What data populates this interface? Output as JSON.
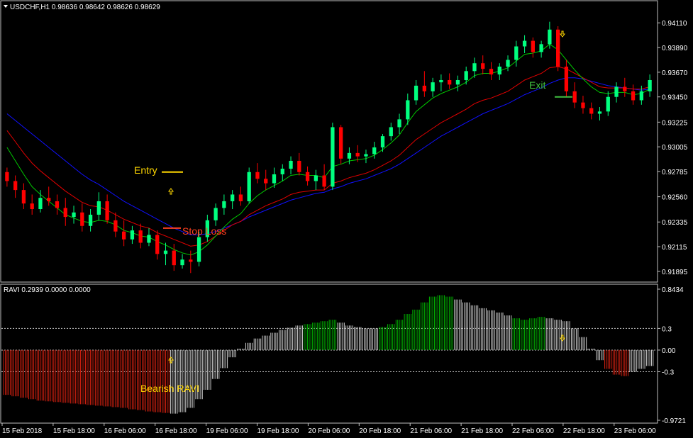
{
  "header": {
    "symbol_line": "USDCHF,H1  0.98636 0.98642 0.98626 0.98629",
    "indicator_line": "RAVI 0.2939 0.0000 0.0000"
  },
  "price_axis": {
    "ticks": [
      "0.94110",
      "0.93890",
      "0.93670",
      "0.93450",
      "0.93225",
      "0.93005",
      "0.92785",
      "0.92560",
      "0.92335",
      "0.92115",
      "0.91895"
    ]
  },
  "ravi_axis": {
    "ticks": [
      "0.8434",
      "0.3",
      "0.00",
      "-0.3",
      "-0.9721"
    ]
  },
  "time_axis": {
    "ticks": [
      "15 Feb 2018",
      "15 Feb 18:00",
      "16 Feb 06:00",
      "16 Feb 18:00",
      "19 Feb 06:00",
      "19 Feb 18:00",
      "20 Feb 06:00",
      "20 Feb 18:00",
      "21 Feb 06:00",
      "21 Feb 18:00",
      "22 Feb 06:00",
      "22 Feb 18:00",
      "23 Feb 06:00"
    ]
  },
  "annotations": {
    "entry": "Entry",
    "stop_loss": "Stop Loss",
    "exit": "Exit",
    "bearish_ravi": "Bearish RAVI"
  },
  "colors": {
    "background": "#000000",
    "bull_candle": "#00ff7f",
    "bear_candle": "#ff0000",
    "ma_fast": "#00c800",
    "ma_mid": "#e00000",
    "ma_slow": "#1010ff",
    "ravi_bull": "#00b000",
    "ravi_bear": "#d02010",
    "ravi_neutral": "#c8c8c8",
    "entry_text": "#ffd700",
    "stop_text": "#ff4020",
    "exit_text": "#40c040",
    "arrow": "#ffd700"
  },
  "chart_data": {
    "type": "candlestick",
    "symbol": "USDCHF",
    "timeframe": "H1",
    "ylim": [
      0.9185,
      0.942
    ],
    "ohlc": [
      [
        0.9278,
        0.9282,
        0.9265,
        0.927
      ],
      [
        0.927,
        0.9275,
        0.9255,
        0.9262
      ],
      [
        0.9262,
        0.9268,
        0.9245,
        0.925
      ],
      [
        0.925,
        0.9258,
        0.924,
        0.9245
      ],
      [
        0.9245,
        0.9262,
        0.9242,
        0.9255
      ],
      [
        0.9255,
        0.9265,
        0.9248,
        0.9252
      ],
      [
        0.9252,
        0.9258,
        0.924,
        0.9246
      ],
      [
        0.9246,
        0.9255,
        0.923,
        0.9238
      ],
      [
        0.9238,
        0.9248,
        0.9232,
        0.9242
      ],
      [
        0.9242,
        0.925,
        0.9225,
        0.923
      ],
      [
        0.923,
        0.9245,
        0.9225,
        0.924
      ],
      [
        0.924,
        0.926,
        0.9235,
        0.9252
      ],
      [
        0.9252,
        0.9258,
        0.9232,
        0.9235
      ],
      [
        0.9235,
        0.9242,
        0.922,
        0.9225
      ],
      [
        0.9225,
        0.9235,
        0.9212,
        0.9218
      ],
      [
        0.9218,
        0.923,
        0.9214,
        0.9226
      ],
      [
        0.9226,
        0.9232,
        0.921,
        0.9215
      ],
      [
        0.9215,
        0.9228,
        0.9212,
        0.9222
      ],
      [
        0.9222,
        0.9226,
        0.92,
        0.9205
      ],
      [
        0.9205,
        0.9215,
        0.9195,
        0.9208
      ],
      [
        0.9208,
        0.9214,
        0.919,
        0.9195
      ],
      [
        0.9195,
        0.9205,
        0.9192,
        0.92
      ],
      [
        0.92,
        0.9208,
        0.9188,
        0.9198
      ],
      [
        0.9198,
        0.9225,
        0.9194,
        0.922
      ],
      [
        0.922,
        0.924,
        0.9216,
        0.9235
      ],
      [
        0.9235,
        0.925,
        0.923,
        0.9246
      ],
      [
        0.9246,
        0.9258,
        0.924,
        0.9252
      ],
      [
        0.9252,
        0.9262,
        0.9245,
        0.9258
      ],
      [
        0.9258,
        0.9265,
        0.9248,
        0.9252
      ],
      [
        0.9252,
        0.9282,
        0.925,
        0.9278
      ],
      [
        0.9278,
        0.9286,
        0.9268,
        0.9272
      ],
      [
        0.9272,
        0.928,
        0.9262,
        0.9268
      ],
      [
        0.9268,
        0.9282,
        0.9264,
        0.9276
      ],
      [
        0.9276,
        0.9285,
        0.927,
        0.9281
      ],
      [
        0.9281,
        0.9292,
        0.9276,
        0.9288
      ],
      [
        0.9288,
        0.9295,
        0.9275,
        0.9278
      ],
      [
        0.9278,
        0.9283,
        0.9266,
        0.927
      ],
      [
        0.927,
        0.928,
        0.9262,
        0.9275
      ],
      [
        0.9275,
        0.9285,
        0.9262,
        0.9265
      ],
      [
        0.9265,
        0.9322,
        0.9262,
        0.9318
      ],
      [
        0.9318,
        0.932,
        0.9285,
        0.929
      ],
      [
        0.929,
        0.93,
        0.9285,
        0.9295
      ],
      [
        0.9295,
        0.9302,
        0.9287,
        0.9292
      ],
      [
        0.9292,
        0.9298,
        0.9286,
        0.9294
      ],
      [
        0.9294,
        0.9305,
        0.929,
        0.93
      ],
      [
        0.93,
        0.9312,
        0.9296,
        0.931
      ],
      [
        0.931,
        0.9322,
        0.9306,
        0.9318
      ],
      [
        0.9318,
        0.933,
        0.9312,
        0.9325
      ],
      [
        0.9325,
        0.9348,
        0.932,
        0.9342
      ],
      [
        0.9342,
        0.936,
        0.9338,
        0.9355
      ],
      [
        0.9355,
        0.9368,
        0.9345,
        0.935
      ],
      [
        0.935,
        0.9362,
        0.9345,
        0.9358
      ],
      [
        0.9358,
        0.9365,
        0.935,
        0.936
      ],
      [
        0.936,
        0.9366,
        0.9352,
        0.9356
      ],
      [
        0.9356,
        0.9364,
        0.935,
        0.936
      ],
      [
        0.936,
        0.9372,
        0.9356,
        0.9368
      ],
      [
        0.9368,
        0.938,
        0.9362,
        0.9375
      ],
      [
        0.9375,
        0.9382,
        0.9365,
        0.937
      ],
      [
        0.937,
        0.9376,
        0.936,
        0.9365
      ],
      [
        0.9365,
        0.9375,
        0.936,
        0.9372
      ],
      [
        0.9372,
        0.9382,
        0.9368,
        0.9378
      ],
      [
        0.9378,
        0.9395,
        0.9372,
        0.939
      ],
      [
        0.939,
        0.94,
        0.9384,
        0.9395
      ],
      [
        0.9395,
        0.9398,
        0.938,
        0.9385
      ],
      [
        0.9385,
        0.9395,
        0.938,
        0.9392
      ],
      [
        0.9392,
        0.9412,
        0.9388,
        0.9405
      ],
      [
        0.9405,
        0.9408,
        0.9368,
        0.9372
      ],
      [
        0.9372,
        0.9378,
        0.9345,
        0.935
      ],
      [
        0.935,
        0.9358,
        0.9335,
        0.934
      ],
      [
        0.934,
        0.9346,
        0.933,
        0.9335
      ],
      [
        0.9335,
        0.934,
        0.9325,
        0.933
      ],
      [
        0.933,
        0.9336,
        0.9324,
        0.9332
      ],
      [
        0.9332,
        0.935,
        0.9328,
        0.9345
      ],
      [
        0.9345,
        0.9358,
        0.934,
        0.9354
      ],
      [
        0.9354,
        0.9362,
        0.9345,
        0.935
      ],
      [
        0.935,
        0.9356,
        0.9338,
        0.9342
      ],
      [
        0.9342,
        0.9355,
        0.9338,
        0.935
      ],
      [
        0.935,
        0.9365,
        0.9345,
        0.936
      ]
    ],
    "ma_fast": [
      0.93,
      0.9288,
      0.9276,
      0.9265,
      0.9258,
      0.9252,
      0.9246,
      0.924,
      0.9237,
      0.9234,
      0.9233,
      0.9235,
      0.9234,
      0.9231,
      0.9226,
      0.9224,
      0.9221,
      0.922,
      0.9216,
      0.9213,
      0.9209,
      0.9206,
      0.9204,
      0.9207,
      0.9213,
      0.9221,
      0.9229,
      0.9236,
      0.9241,
      0.925,
      0.9257,
      0.9262,
      0.9266,
      0.927,
      0.9275,
      0.9276,
      0.9275,
      0.9275,
      0.9273,
      0.9283,
      0.9285,
      0.9288,
      0.9289,
      0.929,
      0.9293,
      0.9298,
      0.9304,
      0.9311,
      0.9322,
      0.9332,
      0.9338,
      0.9344,
      0.9348,
      0.9351,
      0.9354,
      0.9358,
      0.9364,
      0.9366,
      0.9366,
      0.9368,
      0.9371,
      0.9377,
      0.9383,
      0.9384,
      0.9386,
      0.9392,
      0.9387,
      0.9378,
      0.9369,
      0.9361,
      0.9354,
      0.9349,
      0.9348,
      0.9349,
      0.9349,
      0.9347,
      0.9348,
      0.9352
    ],
    "ma_mid": [
      0.9315,
      0.9305,
      0.9295,
      0.9286,
      0.9279,
      0.9273,
      0.9267,
      0.9261,
      0.9256,
      0.9251,
      0.9248,
      0.9247,
      0.9244,
      0.924,
      0.9236,
      0.9233,
      0.923,
      0.9228,
      0.9224,
      0.9221,
      0.9218,
      0.9215,
      0.9212,
      0.9213,
      0.9216,
      0.9221,
      0.9226,
      0.9231,
      0.9234,
      0.924,
      0.9244,
      0.9248,
      0.9251,
      0.9254,
      0.9258,
      0.926,
      0.9261,
      0.9262,
      0.9262,
      0.9268,
      0.927,
      0.9273,
      0.9275,
      0.9277,
      0.928,
      0.9284,
      0.9288,
      0.9293,
      0.93,
      0.9307,
      0.9312,
      0.9317,
      0.9322,
      0.9326,
      0.933,
      0.9334,
      0.9339,
      0.9342,
      0.9344,
      0.9347,
      0.935,
      0.9355,
      0.936,
      0.9363,
      0.9366,
      0.9371,
      0.9372,
      0.937,
      0.9366,
      0.9362,
      0.9358,
      0.9354,
      0.9353,
      0.9353,
      0.9353,
      0.9352,
      0.9352,
      0.9354
    ],
    "ma_slow": [
      0.933,
      0.9324,
      0.9318,
      0.9312,
      0.9306,
      0.93,
      0.9294,
      0.9288,
      0.9282,
      0.9276,
      0.9271,
      0.9267,
      0.9262,
      0.9257,
      0.9252,
      0.9248,
      0.9244,
      0.924,
      0.9236,
      0.9232,
      0.9228,
      0.9225,
      0.9222,
      0.9222,
      0.9223,
      0.9225,
      0.9228,
      0.9231,
      0.9234,
      0.9238,
      0.9241,
      0.9244,
      0.9247,
      0.925,
      0.9253,
      0.9255,
      0.9257,
      0.9259,
      0.926,
      0.9263,
      0.9265,
      0.9268,
      0.927,
      0.9272,
      0.9275,
      0.9278,
      0.9281,
      0.9285,
      0.929,
      0.9295,
      0.93,
      0.9305,
      0.931,
      0.9314,
      0.9318,
      0.9322,
      0.9326,
      0.933,
      0.9333,
      0.9336,
      0.9339,
      0.9343,
      0.9347,
      0.935,
      0.9353,
      0.9357,
      0.936,
      0.9362,
      0.9362,
      0.9361,
      0.9359,
      0.9357,
      0.9355,
      0.9354,
      0.9353,
      0.9352,
      0.9351,
      0.9352
    ],
    "ravi": {
      "ylim": [
        -0.9721,
        0.8434
      ],
      "levels": [
        0.3,
        0.0,
        -0.3
      ],
      "values": [
        -0.62,
        -0.64,
        -0.66,
        -0.68,
        -0.7,
        -0.71,
        -0.72,
        -0.73,
        -0.74,
        -0.75,
        -0.76,
        -0.77,
        -0.78,
        -0.79,
        -0.8,
        -0.82,
        -0.83,
        -0.85,
        -0.86,
        -0.87,
        -0.88,
        -0.86,
        -0.8,
        -0.68,
        -0.55,
        -0.4,
        -0.25,
        -0.1,
        0.02,
        0.1,
        0.16,
        0.2,
        0.24,
        0.28,
        0.31,
        0.34,
        0.36,
        0.38,
        0.4,
        0.42,
        0.38,
        0.34,
        0.32,
        0.3,
        0.3,
        0.32,
        0.36,
        0.42,
        0.5,
        0.56,
        0.66,
        0.74,
        0.76,
        0.74,
        0.7,
        0.66,
        0.62,
        0.58,
        0.55,
        0.52,
        0.48,
        0.44,
        0.42,
        0.44,
        0.46,
        0.44,
        0.42,
        0.4,
        0.3,
        0.18,
        0.02,
        -0.14,
        -0.26,
        -0.34,
        -0.36,
        -0.3,
        -0.26,
        -0.22
      ],
      "colors": [
        "bear",
        "bear",
        "bear",
        "bear",
        "bear",
        "bear",
        "bear",
        "bear",
        "bear",
        "bear",
        "bear",
        "bear",
        "bear",
        "bear",
        "bear",
        "bear",
        "bear",
        "bear",
        "bear",
        "bear",
        "neutral",
        "neutral",
        "neutral",
        "neutral",
        "neutral",
        "neutral",
        "neutral",
        "neutral",
        "neutral",
        "neutral",
        "neutral",
        "neutral",
        "neutral",
        "neutral",
        "neutral",
        "neutral",
        "bull",
        "bull",
        "bull",
        "bull",
        "neutral",
        "neutral",
        "neutral",
        "neutral",
        "neutral",
        "bull",
        "bull",
        "bull",
        "bull",
        "bull",
        "bull",
        "bull",
        "bull",
        "bull",
        "neutral",
        "neutral",
        "neutral",
        "neutral",
        "neutral",
        "neutral",
        "neutral",
        "bull",
        "bull",
        "bull",
        "bull",
        "neutral",
        "neutral",
        "neutral",
        "neutral",
        "neutral",
        "neutral",
        "neutral",
        "bear",
        "bear",
        "bear",
        "neutral",
        "neutral",
        "neutral"
      ]
    },
    "markers": {
      "entry_index": 29,
      "exit_index": 68,
      "entry_price": 0.9278,
      "exit_price": 0.9345,
      "stop_loss_price": 0.9228,
      "up_arrow_index": 31,
      "down_arrow_index": 66
    }
  }
}
